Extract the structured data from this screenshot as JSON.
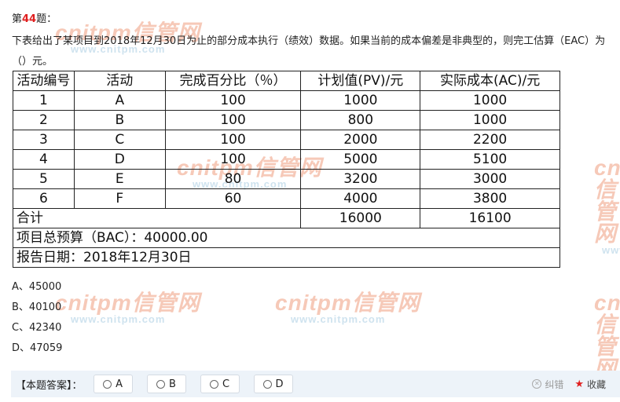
{
  "question": {
    "prefix": "第",
    "number": "44",
    "suffix": "题：",
    "stem": "下表给出了某项目到2018年12月30日为止的部分成本执行（绩效）数据。如果当前的成本偏差是非典型的，则完工估算（EAC）为（）元。"
  },
  "table": {
    "headers": [
      "活动编号",
      "活动",
      "完成百分比（％）",
      "计划值(PV)/元",
      "实际成本(AC)/元"
    ],
    "rows": [
      [
        "1",
        "A",
        "100",
        "1000",
        "1000"
      ],
      [
        "2",
        "B",
        "100",
        "800",
        "1000"
      ],
      [
        "3",
        "C",
        "100",
        "2000",
        "2200"
      ],
      [
        "4",
        "D",
        "100",
        "5000",
        "5100"
      ],
      [
        "5",
        "E",
        "80",
        "3200",
        "3000"
      ],
      [
        "6",
        "F",
        "60",
        "4000",
        "3800"
      ]
    ],
    "total_label": "合计",
    "total_pv": "16000",
    "total_ac": "16100",
    "bac": "项目总预算（BAC）：40000.00",
    "report_date": "报告日期：2018年12月30日"
  },
  "options": [
    "A、45000",
    "B、40100",
    "C、42340",
    "D、47059"
  ],
  "answer_bar": {
    "label": "【本题答案】：",
    "choices": [
      "A",
      "B",
      "C",
      "D"
    ],
    "report": "纠错",
    "favorite": "收藏"
  },
  "watermark": {
    "brand": "cnitpm信管网",
    "url": "www.cnitpm.com"
  },
  "colors": {
    "question_number": "#e02020",
    "watermark_brand": "#f6c9b8",
    "watermark_url": "#cfe3ef",
    "answer_bar_bg": "#edf3f9",
    "star": "#e02020"
  }
}
